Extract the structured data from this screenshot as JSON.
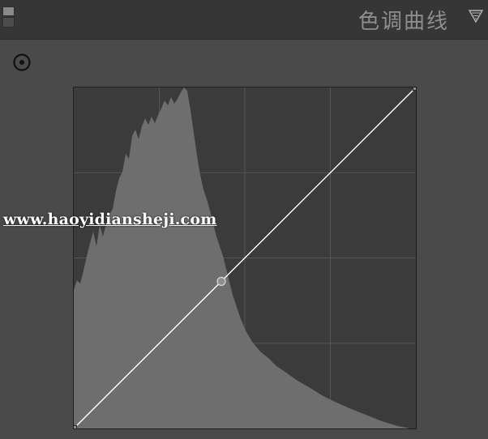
{
  "header": {
    "title": "色调曲线"
  },
  "icons": {
    "panel_toggle": "panel-toggle-icon",
    "collapse": "triangle-down-icon",
    "target_adjust": "target-adjust-icon"
  },
  "curve": {
    "input_range": [
      0,
      255
    ],
    "output_range": [
      0,
      255
    ],
    "control_points": [
      {
        "input": 0,
        "output": 0
      },
      {
        "input": 110,
        "output": 110
      },
      {
        "input": 255,
        "output": 255
      }
    ],
    "grid_divisions": 4
  },
  "watermark": {
    "text": "www.haoyidiansheji.com"
  },
  "colors": {
    "background": "#4a4a4a",
    "header": "#363636",
    "graph_bg": "#3b3b3b",
    "histogram": "#6e6e6e",
    "curve_line": "#ffffff",
    "title_text": "#8e8e8e"
  }
}
